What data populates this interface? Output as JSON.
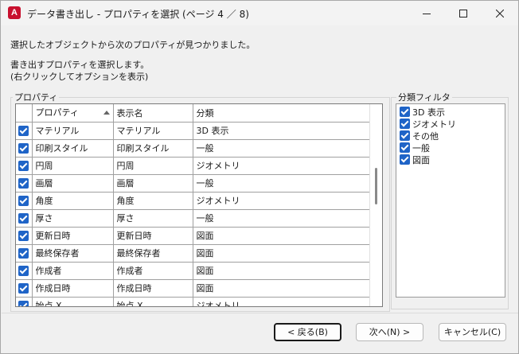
{
  "window": {
    "title": "データ書き出し - プロパティを選択 (ページ 4 ／ 8)",
    "app_icon_letter": "A",
    "accent_color": "#c8102e"
  },
  "messages": {
    "line1": "選択したオブジェクトから次のプロパティが見つかりました。",
    "line2": "書き出すプロパティを選択します。",
    "line3": "(右クリックしてオプションを表示)"
  },
  "properties_group": {
    "label": "プロパティ",
    "columns": [
      "プロパティ",
      "表示名",
      "分類"
    ],
    "rows": [
      {
        "checked": true,
        "property": "マテリアル",
        "display": "マテリアル",
        "category": "3D 表示"
      },
      {
        "checked": true,
        "property": "印刷スタイル",
        "display": "印刷スタイル",
        "category": "一般"
      },
      {
        "checked": true,
        "property": "円周",
        "display": "円周",
        "category": "ジオメトリ"
      },
      {
        "checked": true,
        "property": "画層",
        "display": "画層",
        "category": "一般"
      },
      {
        "checked": true,
        "property": "角度",
        "display": "角度",
        "category": "ジオメトリ"
      },
      {
        "checked": true,
        "property": "厚さ",
        "display": "厚さ",
        "category": "一般"
      },
      {
        "checked": true,
        "property": "更新日時",
        "display": "更新日時",
        "category": "図面"
      },
      {
        "checked": true,
        "property": "最終保存者",
        "display": "最終保存者",
        "category": "図面"
      },
      {
        "checked": true,
        "property": "作成者",
        "display": "作成者",
        "category": "図面"
      },
      {
        "checked": true,
        "property": "作成日時",
        "display": "作成日時",
        "category": "図面"
      },
      {
        "checked": true,
        "property": "始点 X",
        "display": "始点 X",
        "category": "ジオメトリ"
      }
    ]
  },
  "filter_group": {
    "label": "分類フィルタ",
    "items": [
      {
        "checked": true,
        "label": "3D 表示"
      },
      {
        "checked": true,
        "label": "ジオメトリ"
      },
      {
        "checked": true,
        "label": "その他"
      },
      {
        "checked": true,
        "label": "一般"
      },
      {
        "checked": true,
        "label": "図面"
      }
    ]
  },
  "buttons": {
    "back": "< 戻る(B)",
    "next": "次へ(N) >",
    "cancel": "キャンセル(C)"
  }
}
